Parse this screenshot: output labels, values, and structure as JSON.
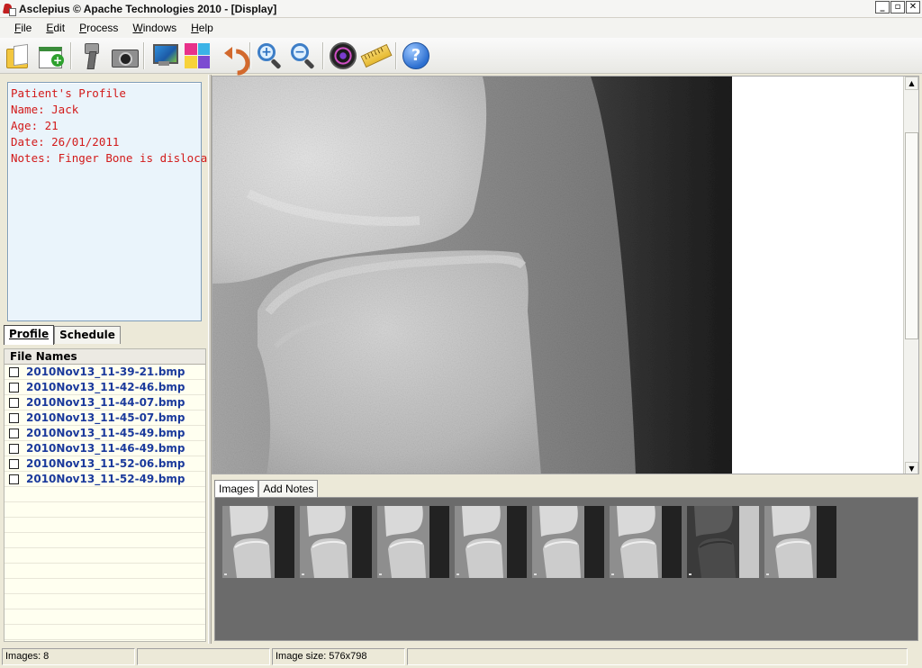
{
  "window": {
    "title": "Asclepius © Apache Technologies 2010 - [Display]",
    "controls": [
      "_",
      "▫",
      "✕"
    ]
  },
  "menu": [
    "File",
    "Edit",
    "Process",
    "Windows",
    "Help"
  ],
  "toolbar": {
    "icons": [
      "open-folder-icon",
      "new-window-icon",
      "scanner-icon",
      "camera-icon",
      "monitor-icon",
      "color-mosaic-icon",
      "undo-icon",
      "zoom-in-icon",
      "zoom-out-icon",
      "lens-icon",
      "ruler-icon",
      "help-icon"
    ],
    "zoom_in_symbol": "+",
    "zoom_out_symbol": "−",
    "help_symbol": "?"
  },
  "profile": {
    "heading": "Patient's Profile",
    "name": "Name: Jack",
    "age": "Age: 21",
    "date": "Date: 26/01/2011",
    "notes": "Notes: Finger Bone is dislocated"
  },
  "left_tabs": {
    "profile": "Profile",
    "schedule": "Schedule",
    "active": "Profile"
  },
  "files": {
    "header": "File Names",
    "items": [
      "2010Nov13_11-39-21.bmp",
      "2010Nov13_11-42-46.bmp",
      "2010Nov13_11-44-07.bmp",
      "2010Nov13_11-45-07.bmp",
      "2010Nov13_11-45-49.bmp",
      "2010Nov13_11-46-49.bmp",
      "2010Nov13_11-52-06.bmp",
      "2010Nov13_11-52-49.bmp"
    ]
  },
  "bottom_tabs": {
    "images": "Images",
    "add_notes": "Add Notes",
    "active": "Images"
  },
  "thumbnails_count": 8,
  "status": {
    "images": "Images: 8",
    "panel2": "",
    "image_size": "Image size: 576x798",
    "panel4": ""
  },
  "colors": {
    "profile_text": "#d21a1a",
    "file_name_text": "#1b3a9c",
    "profile_bg": "#eaf4fb",
    "files_bg": "#fffff0",
    "thumb_panel_bg": "#6b6b6b"
  }
}
